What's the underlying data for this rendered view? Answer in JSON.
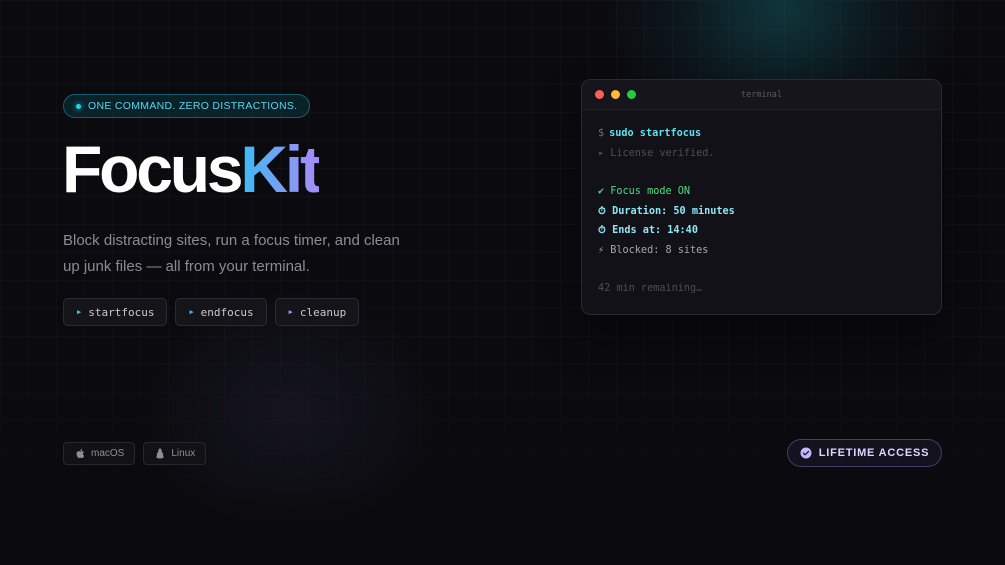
{
  "badge": {
    "text": "ONE COMMAND. ZERO DISTRACTIONS."
  },
  "hero": {
    "title_part1": "Focus",
    "title_part2": "Kit",
    "subtitle": "Block distracting sites, run a focus timer, and clean up junk files — all from your terminal."
  },
  "commands": [
    {
      "label": "startfocus",
      "icon": "play-triangle-icon",
      "color": "#22d3ee"
    },
    {
      "label": "endfocus",
      "icon": "play-triangle-icon",
      "color": "#38bdf8"
    },
    {
      "label": "cleanup",
      "icon": "play-triangle-icon",
      "color": "#a78bfa"
    }
  ],
  "platforms": [
    {
      "label": "macOS",
      "icon": "apple-icon"
    },
    {
      "label": "Linux",
      "icon": "linux-icon"
    }
  ],
  "terminal": {
    "title": "terminal",
    "lights": [
      "#ff5f57",
      "#febc2e",
      "#28c840"
    ],
    "prompt_symbol": "$",
    "command": "sudo startfocus",
    "license": "▸ License verified.",
    "focus_mode": "✔ Focus mode ON",
    "duration": "⏱ Duration: 50 minutes",
    "ends_at": "⏱ Ends at: 14:40",
    "blocked": "⚡ Blocked: 8 sites",
    "remaining": "42 min remaining…"
  },
  "cta": {
    "label": "LIFETIME ACCESS",
    "icon": "check-circle-icon"
  },
  "colors": {
    "background": "#0b0b0f",
    "accent_cyan": "#22d3ee",
    "accent_violet": "#a78bfa"
  }
}
